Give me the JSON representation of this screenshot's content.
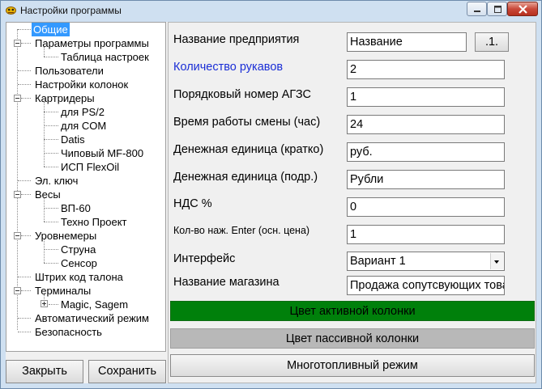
{
  "window": {
    "title": "Настройки программы",
    "buttons": [
      "minimize",
      "maximize",
      "close"
    ]
  },
  "tree": {
    "items": [
      {
        "label": "Общие",
        "selected": true
      },
      {
        "label": "Параметры программы"
      },
      {
        "label": "Таблица настроек"
      },
      {
        "label": "Пользователи"
      },
      {
        "label": "Настройки колонок"
      },
      {
        "label": "Картридеры"
      },
      {
        "label": "для PS/2"
      },
      {
        "label": "для COM"
      },
      {
        "label": "Datis"
      },
      {
        "label": "Чиповый MF-800"
      },
      {
        "label": "ИСП FlexOil"
      },
      {
        "label": "Эл. ключ"
      },
      {
        "label": "Весы"
      },
      {
        "label": "ВП-60"
      },
      {
        "label": "Техно Проект"
      },
      {
        "label": "Уровнемеры"
      },
      {
        "label": "Струна"
      },
      {
        "label": "Сенсор"
      },
      {
        "label": "Штрих код талона"
      },
      {
        "label": "Терминалы"
      },
      {
        "label": "Magic, Sagem"
      },
      {
        "label": "Автоматический режим"
      },
      {
        "label": "Безопасность"
      }
    ]
  },
  "buttons": {
    "close_label": "Закрыть",
    "save_label": "Сохранить"
  },
  "form": {
    "company_name_label": "Название предприятия",
    "company_name_value": "Название",
    "company_name_button": ".1.",
    "hoses_label": "Количество рукавов",
    "hoses_value": "2",
    "station_number_label": "Порядковый номер АГЗС",
    "station_number_value": "1",
    "shift_time_label": "Время работы смены (час)",
    "shift_time_value": "24",
    "currency_short_label": "Денежная единица (кратко)",
    "currency_short_value": "руб.",
    "currency_sub_label": "Денежная единица (подр.)",
    "currency_sub_value": "Рубли",
    "vat_label": "НДС %",
    "vat_value": "0",
    "enter_presses_label": "Кол-во наж. Enter (осн. цена)",
    "enter_presses_value": "1",
    "interface_label": "Интерфейс",
    "interface_value": "Вариант 1",
    "shop_name_label": "Название магазина",
    "shop_name_value": "Продажа сопутсвующих товаров",
    "active_color_label": "Цвет активной колонки",
    "passive_color_label": "Цвет пассивной колонки",
    "multifuel_label": "Многотопливный режим"
  },
  "colors": {
    "active_column": "#00800b",
    "passive_column": "#b8b8b8",
    "selection": "#3399ff",
    "blue_label": "#1a2ed6"
  }
}
